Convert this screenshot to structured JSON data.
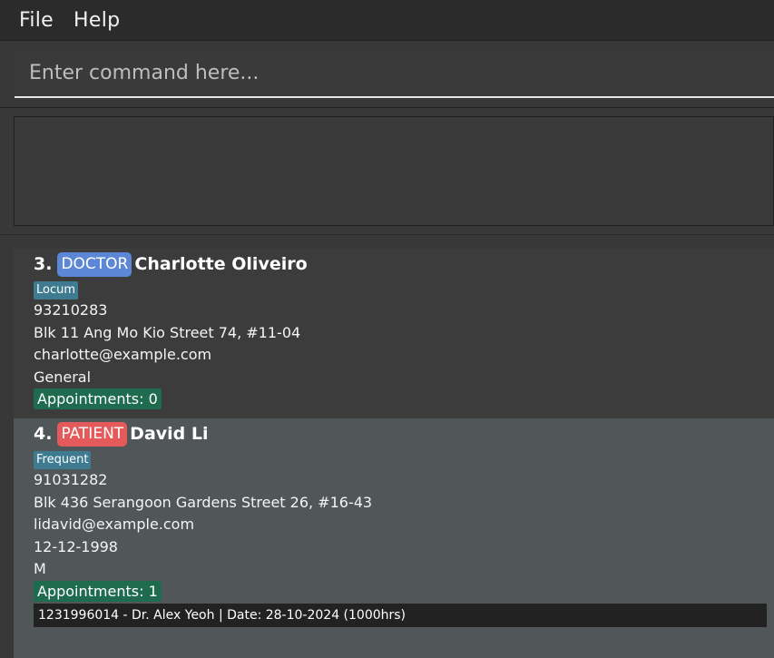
{
  "menu": {
    "file": "File",
    "help": "Help"
  },
  "command": {
    "placeholder": "Enter command here..."
  },
  "persons": [
    {
      "index": "3.",
      "role": "DOCTOR",
      "role_color": "#5b87d6",
      "name": "Charlotte Oliveiro",
      "tag": "Locum",
      "phone": "93210283",
      "address": "Blk 11 Ang Mo Kio Street 74, #11-04",
      "email": "charlotte@example.com",
      "specialty": "General",
      "appointments": "Appointments: 0"
    },
    {
      "index": "4.",
      "role": "PATIENT",
      "role_color": "#e45a5a",
      "name": "David Li",
      "tag": "Frequent",
      "phone": "91031282",
      "address": "Blk 436 Serangoon Gardens Street 26, #16-43",
      "email": "lidavid@example.com",
      "dob": "12-12-1998",
      "gender": "M",
      "appointments": "Appointments: 1",
      "appointment_items": [
        "1231996014 - Dr. Alex Yeoh | Date: 28-10-2024 (1000hrs)"
      ]
    }
  ],
  "colors": {
    "background": "#383838",
    "menubar": "#2b2b2b",
    "selected_card": "#515658",
    "tag": "#3e7b91",
    "appointments_badge": "#1e6b50"
  }
}
